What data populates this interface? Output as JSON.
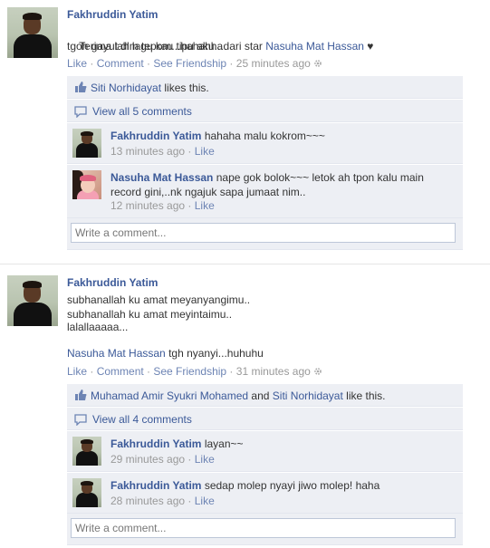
{
  "posts": [
    {
      "author": "Fakhruddin Yatim",
      "text_line1_prefix": "Terima lah lagu kau tipu aku...dari star ",
      "text_line1_tag": "Nasuha Mat Hassan",
      "text_line1_suffix": " ♥",
      "text_line2": "tgoh gayut dlm tepom...hahahha",
      "actions": {
        "like": "Like",
        "comment": "Comment",
        "friendship": "See Friendship",
        "time": "25 minutes ago"
      },
      "likes": {
        "name": "Siti Norhidayat",
        "suffix": " likes this."
      },
      "view_all": "View all 5 comments",
      "comments": [
        {
          "name": "Fakhruddin Yatim",
          "text": "hahaha malu kokrom~~~",
          "time": "13 minutes ago",
          "like": "Like"
        },
        {
          "name": "Nasuha Mat Hassan",
          "text": "nape gok bolok~~~ letok ah tpon kalu main record gini,..nk ngajuk sapa jumaat nim..",
          "time": "12 minutes ago",
          "like": "Like"
        }
      ],
      "write_placeholder": "Write a comment..."
    },
    {
      "author": "Fakhruddin Yatim",
      "text_lines": [
        "subhanallah ku amat meyanyangimu..",
        "subhanallah ku amat meyintaimu..",
        "lalallaaaaa..."
      ],
      "tag_name": "Nasuha Mat Hassan",
      "tag_suffix": " tgh nyanyi...huhuhu",
      "actions": {
        "like": "Like",
        "comment": "Comment",
        "friendship": "See Friendship",
        "time": "31 minutes ago"
      },
      "likes": {
        "name1": "Muhamad Amir Syukri Mohamed",
        "and": " and ",
        "name2": "Siti Norhidayat",
        "suffix": " like this."
      },
      "view_all": "View all 4 comments",
      "comments": [
        {
          "name": "Fakhruddin Yatim",
          "text": "layan~~",
          "time": "29 minutes ago",
          "like": "Like"
        },
        {
          "name": "Fakhruddin Yatim",
          "text": "sedap molep nyayi jiwo molep! haha",
          "time": "28 minutes ago",
          "like": "Like"
        }
      ],
      "write_placeholder": "Write a comment..."
    }
  ],
  "separator": " · ",
  "icons": {
    "gear": "gear-icon",
    "thumb": "thumbs-up-icon",
    "bubble": "comment-bubble-icon"
  },
  "colors": {
    "link": "#3b5998",
    "ufi_bg": "#edeff4",
    "meta": "#999999"
  }
}
